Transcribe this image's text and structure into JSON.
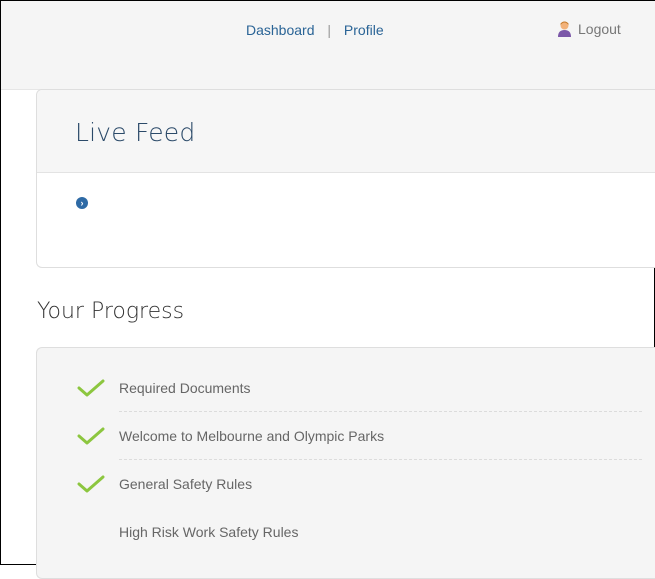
{
  "nav": {
    "dashboard": "Dashboard",
    "separator": "|",
    "profile": "Profile",
    "logout": "Logout"
  },
  "live_feed": {
    "title": "Live Feed"
  },
  "progress": {
    "title": "Your Progress",
    "items": [
      {
        "label": "Required Documents",
        "completed": true
      },
      {
        "label": "Welcome to Melbourne and Olympic Parks",
        "completed": true
      },
      {
        "label": "General Safety Rules",
        "completed": true
      },
      {
        "label": "High Risk Work Safety Rules",
        "completed": false
      }
    ]
  },
  "colors": {
    "link": "#2a6496",
    "check": "#8cc63f",
    "bullet": "#2e6aa5"
  }
}
